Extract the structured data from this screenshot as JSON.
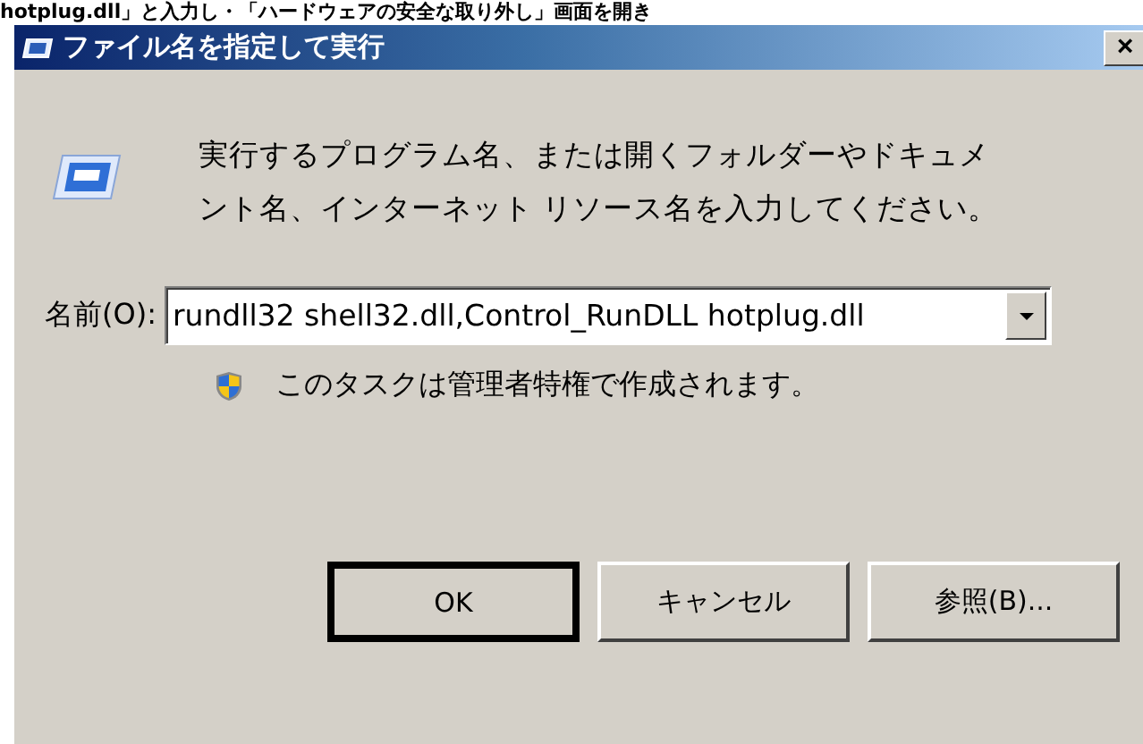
{
  "page_caption": "hotplug.dll」と入力し・「ハードウェアの安全な取り外し」画面を開き",
  "window": {
    "title": "ファイル名を指定して実行",
    "close": "×"
  },
  "description": "実行するプログラム名、または開くフォルダーやドキュメント名、インターネット リソース名を入力してください。",
  "name_field": {
    "label": "名前(O):",
    "value": "rundll32 shell32.dll,Control_RunDLL hotplug.dll"
  },
  "admin_note": "このタスクは管理者特権で作成されます。",
  "buttons": [
    {
      "label": "OK",
      "default": true
    },
    {
      "label": "キャンセル",
      "default": false
    },
    {
      "label": "参照(B)...",
      "default": false
    }
  ]
}
